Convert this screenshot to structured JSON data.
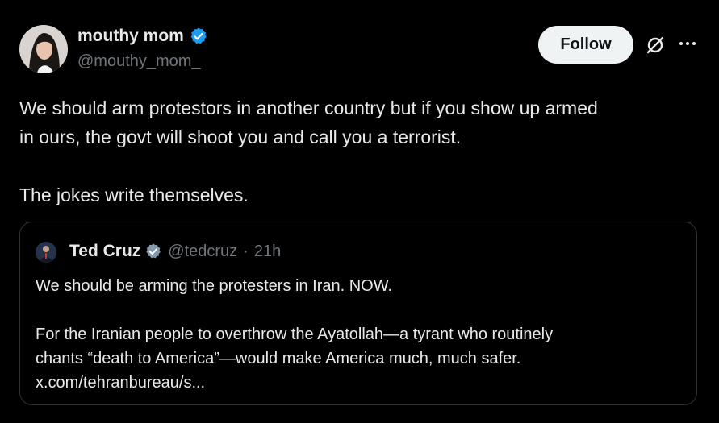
{
  "author": {
    "name": "mouthy mom",
    "handle": "@mouthy_mom_",
    "avatar": "avatar"
  },
  "actions": {
    "follow_label": "Follow",
    "grok_icon": "grok-icon",
    "more_icon": "more-icon"
  },
  "tweet": {
    "line1": "We should arm protestors in another country but if you show up armed",
    "line2": "in ours, the govt will shoot you and call you a terrorist.",
    "line3": "The jokes write themselves."
  },
  "quoted": {
    "name": "Ted Cruz",
    "handle": "@tedcruz",
    "separator": "·",
    "time": "21h",
    "para1": "We should be arming the protesters in Iran. NOW.",
    "para2_line1": "For the Iranian people to overthrow the Ayatollah—a tyrant who routinely",
    "para2_line2": "chants “death to America”—would make America much, much safer.",
    "link": "x.com/tehranbureau/s..."
  },
  "colors": {
    "background": "#000000",
    "text": "#e7e9ea",
    "secondary": "#71767b",
    "verified_blue": "#1d9bf0",
    "verified_gray": "#829aab",
    "border": "#2f3336"
  }
}
